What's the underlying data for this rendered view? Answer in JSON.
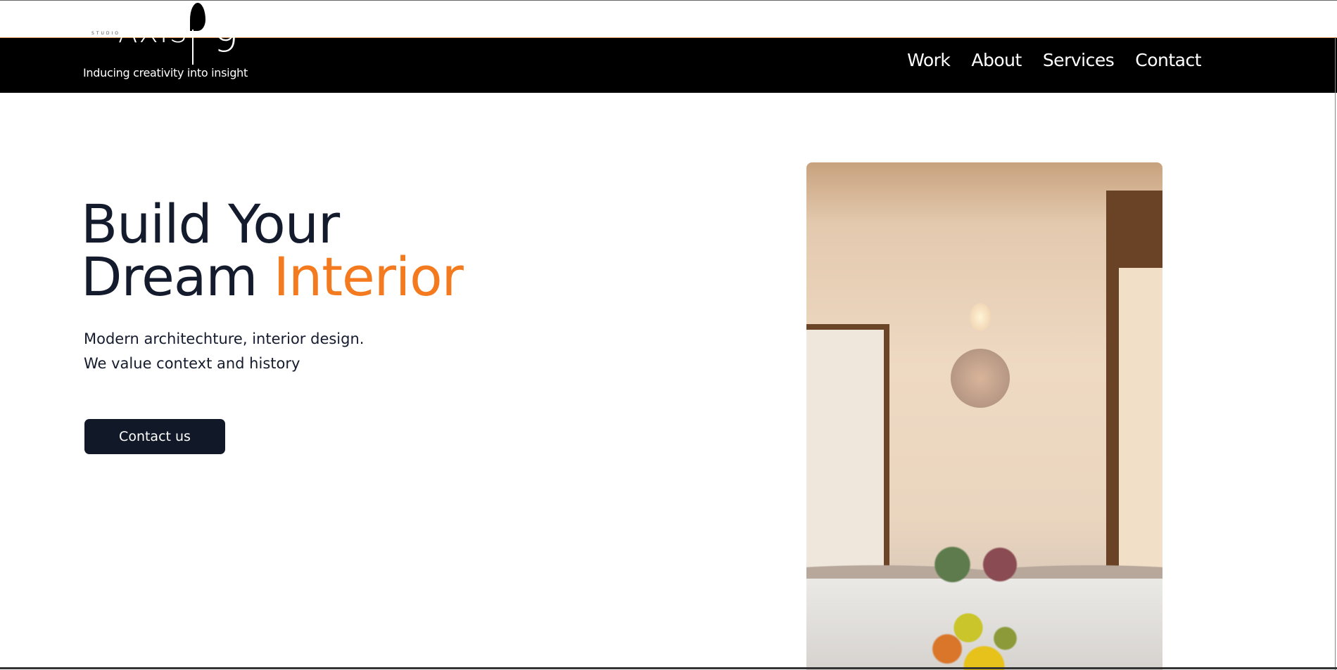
{
  "header": {
    "logo": {
      "studio": "STUDIO",
      "name": "AXIS",
      "number": "9",
      "tagline": "Inducing creativity into insight"
    },
    "nav": [
      "Work",
      "About",
      "Services",
      "Contact"
    ]
  },
  "hero": {
    "title_line1": "Build Your",
    "title_line2_plain": "Dream",
    "title_line2_accent": "Interior",
    "subtitle_line1": "Modern architechture, interior design.",
    "subtitle_line2": "We value context and history",
    "cta_label": "Contact us"
  },
  "colors": {
    "accent": "#f47a1f",
    "dark": "#141b2d",
    "button": "#111827",
    "header": "#000000"
  }
}
